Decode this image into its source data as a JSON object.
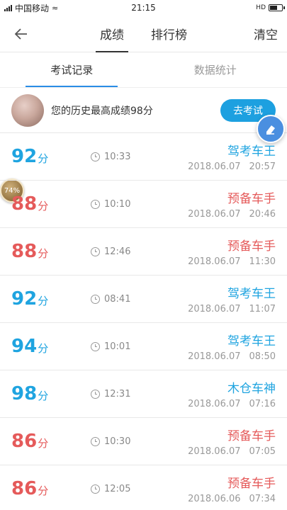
{
  "statusbar": {
    "carrier": "中国移动",
    "time": "21:15",
    "hd": "HD"
  },
  "nav": {
    "tabs": [
      "成绩",
      "排行榜"
    ],
    "active": 0,
    "clear_label": "清空"
  },
  "subtabs": {
    "tabs": [
      "考试记录",
      "数据统计"
    ],
    "active": 0
  },
  "best": {
    "text": "您的历史最高成绩98分",
    "button_label": "去考试"
  },
  "float_badge": "74%",
  "colors": {
    "blue": "#1fa4e0",
    "red": "#e55a5a",
    "accent": "#1da0e0"
  },
  "records": [
    {
      "score": "92",
      "unit": "分",
      "duration": "10:33",
      "title": "驾考车王",
      "date": "2018.06.07",
      "time": "20:57",
      "color": "blue"
    },
    {
      "score": "88",
      "unit": "分",
      "duration": "10:10",
      "title": "预备车手",
      "date": "2018.06.07",
      "time": "20:46",
      "color": "red"
    },
    {
      "score": "88",
      "unit": "分",
      "duration": "12:46",
      "title": "预备车手",
      "date": "2018.06.07",
      "time": "11:30",
      "color": "red"
    },
    {
      "score": "92",
      "unit": "分",
      "duration": "08:41",
      "title": "驾考车王",
      "date": "2018.06.07",
      "time": "11:07",
      "color": "blue"
    },
    {
      "score": "94",
      "unit": "分",
      "duration": "10:01",
      "title": "驾考车王",
      "date": "2018.06.07",
      "time": "08:50",
      "color": "blue"
    },
    {
      "score": "98",
      "unit": "分",
      "duration": "12:31",
      "title": "木仓车神",
      "date": "2018.06.07",
      "time": "07:16",
      "color": "blue"
    },
    {
      "score": "86",
      "unit": "分",
      "duration": "10:30",
      "title": "预备车手",
      "date": "2018.06.07",
      "time": "07:05",
      "color": "red"
    },
    {
      "score": "86",
      "unit": "分",
      "duration": "12:05",
      "title": "预备车手",
      "date": "2018.06.06",
      "time": "07:34",
      "color": "red"
    }
  ]
}
